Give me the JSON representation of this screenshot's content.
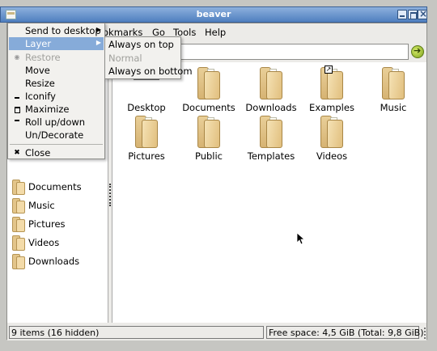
{
  "window": {
    "title": "beaver"
  },
  "menubar": {
    "bookmarks": "okmarks",
    "go": "Go",
    "tools": "Tools",
    "help": "Help"
  },
  "window_menu": {
    "items": [
      {
        "label": "Send to desktop",
        "icon": "",
        "submenu": true,
        "state": "normal"
      },
      {
        "label": "Layer",
        "icon": "",
        "submenu": true,
        "state": "highlighted"
      },
      {
        "label": "Restore",
        "icon": "restore-icon",
        "submenu": false,
        "state": "disabled"
      },
      {
        "label": "Move",
        "icon": "",
        "submenu": false,
        "state": "normal"
      },
      {
        "label": "Resize",
        "icon": "",
        "submenu": false,
        "state": "normal"
      },
      {
        "label": "Iconify",
        "icon": "iconify-icon",
        "submenu": false,
        "state": "normal"
      },
      {
        "label": "Maximize",
        "icon": "maximize-icon",
        "submenu": false,
        "state": "normal"
      },
      {
        "label": "Roll up/down",
        "icon": "rollup-icon",
        "submenu": false,
        "state": "normal"
      },
      {
        "label": "Un/Decorate",
        "icon": "",
        "submenu": false,
        "state": "normal"
      },
      {
        "label": "Close",
        "icon": "close-icon",
        "submenu": false,
        "state": "normal"
      }
    ]
  },
  "layer_submenu": {
    "items": [
      {
        "label": "Always on top",
        "state": "normal"
      },
      {
        "label": "Normal",
        "state": "disabled"
      },
      {
        "label": "Always on bottom",
        "state": "normal"
      }
    ]
  },
  "sidebar": {
    "items": [
      {
        "label": "Documents"
      },
      {
        "label": "Music"
      },
      {
        "label": "Pictures"
      },
      {
        "label": "Videos"
      },
      {
        "label": "Downloads"
      }
    ]
  },
  "files": {
    "items": [
      {
        "label": "Desktop",
        "icon": "desktop-folder-icon"
      },
      {
        "label": "Documents",
        "icon": "folder-icon"
      },
      {
        "label": "Downloads",
        "icon": "folder-icon"
      },
      {
        "label": "Examples",
        "icon": "folder-link-icon"
      },
      {
        "label": "Music",
        "icon": "folder-icon"
      },
      {
        "label": "Pictures",
        "icon": "folder-icon"
      },
      {
        "label": "Public",
        "icon": "folder-icon"
      },
      {
        "label": "Templates",
        "icon": "folder-icon"
      },
      {
        "label": "Videos",
        "icon": "folder-icon"
      }
    ]
  },
  "status": {
    "items": "9 items (16 hidden)",
    "free_space": "Free space: 4,5 GiB (Total: 9,8 GiB)"
  }
}
